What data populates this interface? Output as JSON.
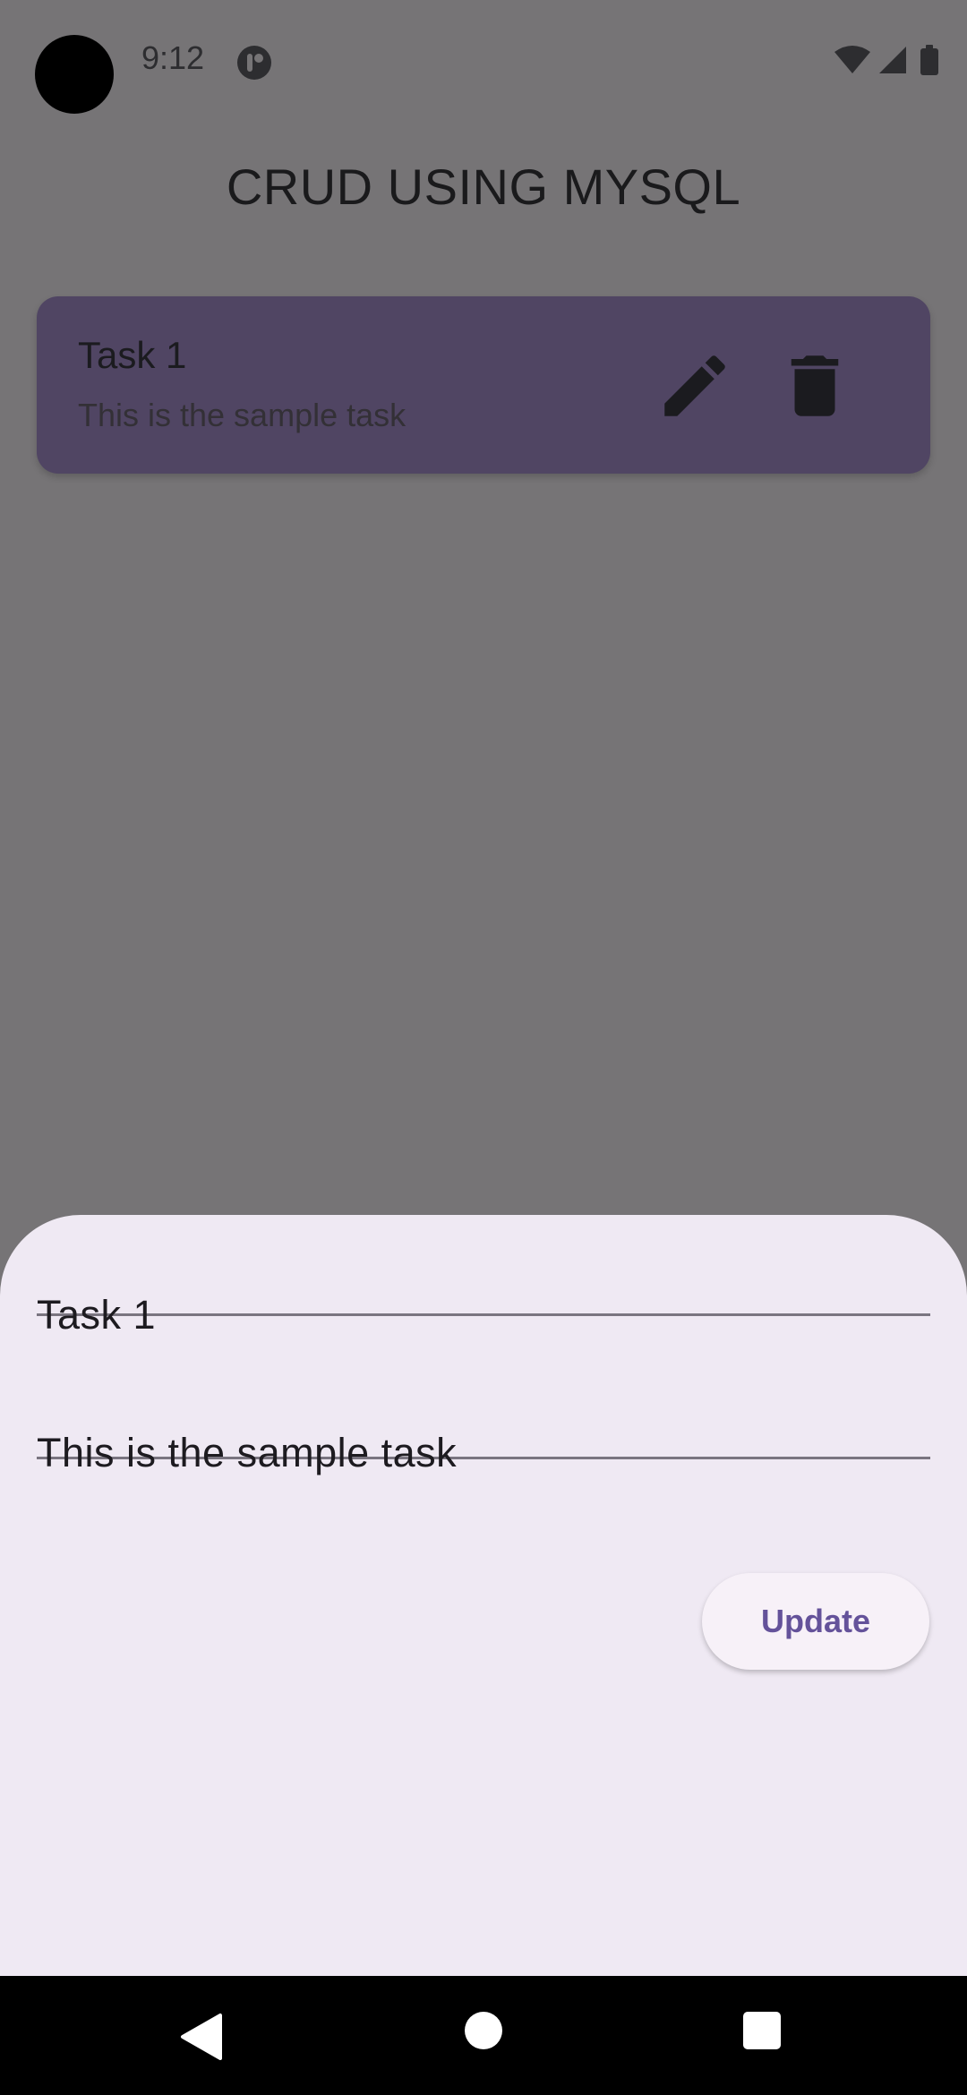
{
  "status_bar": {
    "time": "9:12",
    "notification_icon": "app-notification-icon",
    "icons": [
      "wifi-icon",
      "cellular-signal-icon",
      "battery-icon"
    ]
  },
  "app": {
    "title": "CRUD USING MYSQL"
  },
  "tasks": [
    {
      "title": "Task 1",
      "description": "This is the sample task",
      "actions": [
        "edit-icon",
        "delete-icon"
      ]
    }
  ],
  "sheet": {
    "title_value": "Task 1",
    "description_value": "This is the sample task",
    "update_label": "Update"
  },
  "nav": {
    "buttons": [
      "back-icon",
      "home-icon",
      "recents-icon"
    ]
  },
  "colors": {
    "scrim": "#767476",
    "card": "#504563",
    "sheet": "#efe9f3",
    "accent": "#64529a"
  }
}
